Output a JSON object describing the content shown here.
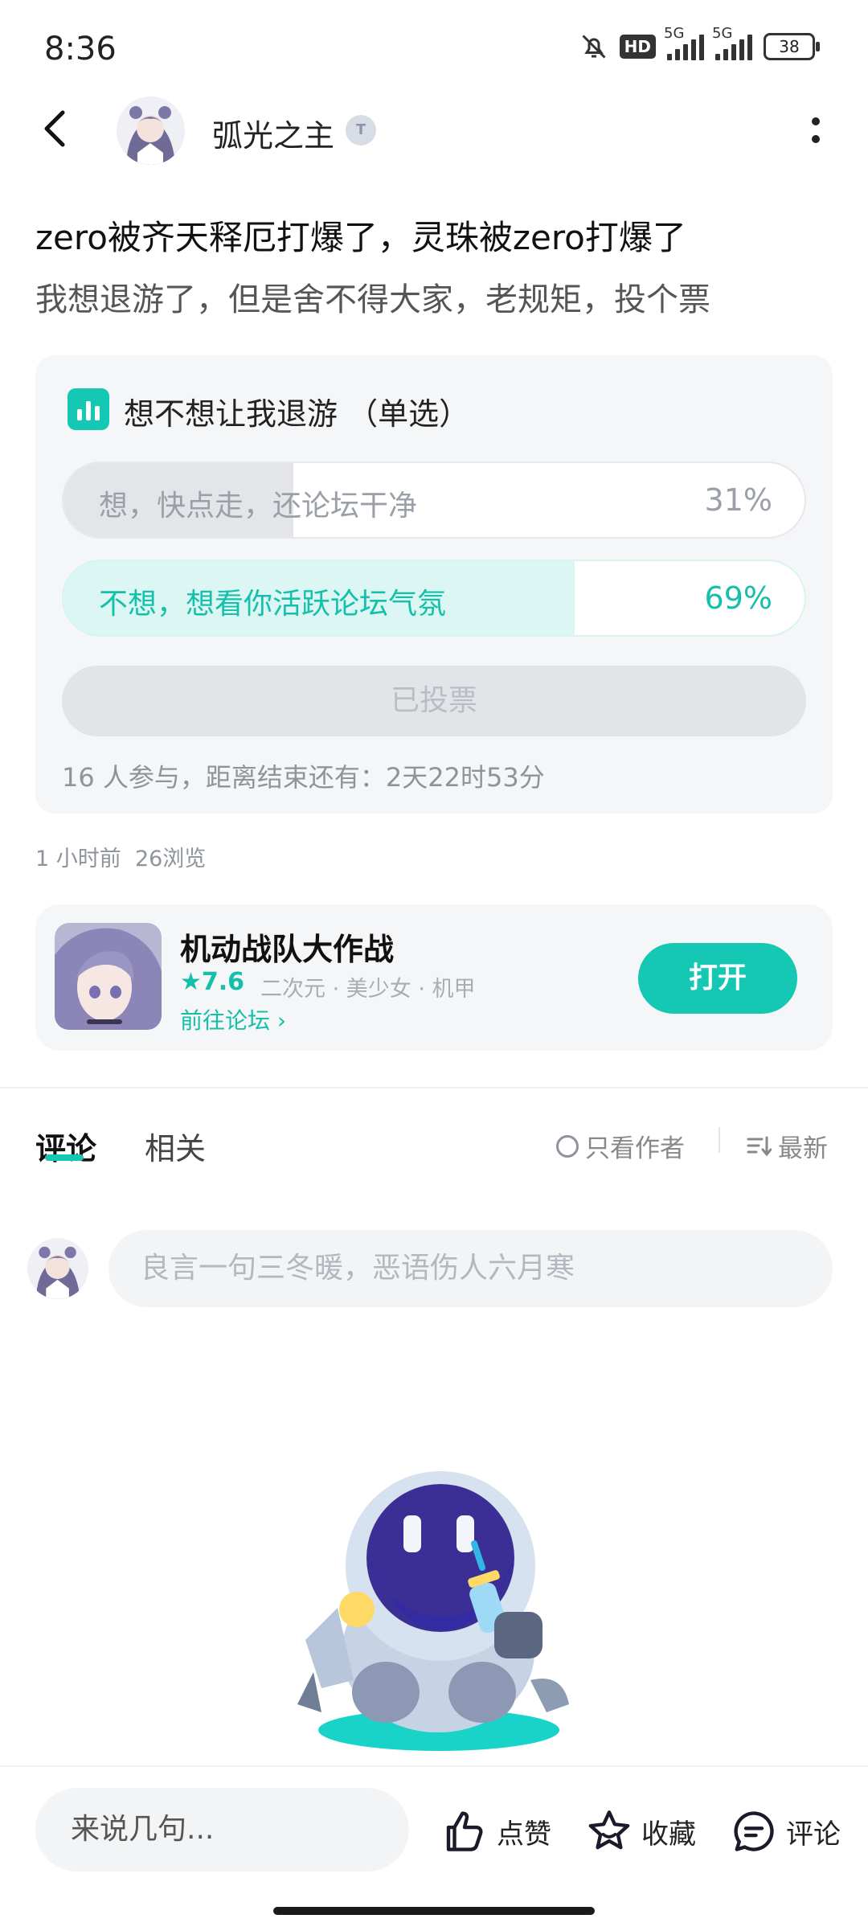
{
  "status_bar": {
    "time": "8:36",
    "hd_label": "HD",
    "signal1_label": "5G",
    "signal2_label": "5G",
    "battery": "38"
  },
  "header": {
    "author_name": "弧光之主",
    "badge_text": "T"
  },
  "post": {
    "title": "zero被齐天释厄打爆了，灵珠被zero打爆了",
    "body": "我想退游了，但是舍不得大家，老规矩，投个票",
    "time_ago": "1 小时前",
    "views": "26浏览"
  },
  "poll": {
    "title": "想不想让我退游 （单选）",
    "options": [
      {
        "label": "想，快点走，还论坛干净",
        "percent_text": "31%",
        "percent": 31
      },
      {
        "label": "不想，想看你活跃论坛气氛",
        "percent_text": "69%",
        "percent": 69
      }
    ],
    "voted_label": "已投票",
    "meta": "16 人参与，距离结束还有：2天22时53分"
  },
  "game": {
    "name": "机动战队大作战",
    "rating": "7.6",
    "tags": "二次元 · 美少女 · 机甲",
    "forum_link": "前往论坛",
    "open_label": "打开"
  },
  "tabs": {
    "comment": "评论",
    "related": "相关",
    "author_only": "只看作者",
    "sort": "最新"
  },
  "comment_placeholder": "良言一句三冬暖，恶语伤人六月寒",
  "bottom_bar": {
    "input_placeholder": "来说几句...",
    "like": "点赞",
    "favorite": "收藏",
    "comment": "评论"
  },
  "colors": {
    "accent": "#15c8b4",
    "poll_bg": "#f5f6f8"
  }
}
